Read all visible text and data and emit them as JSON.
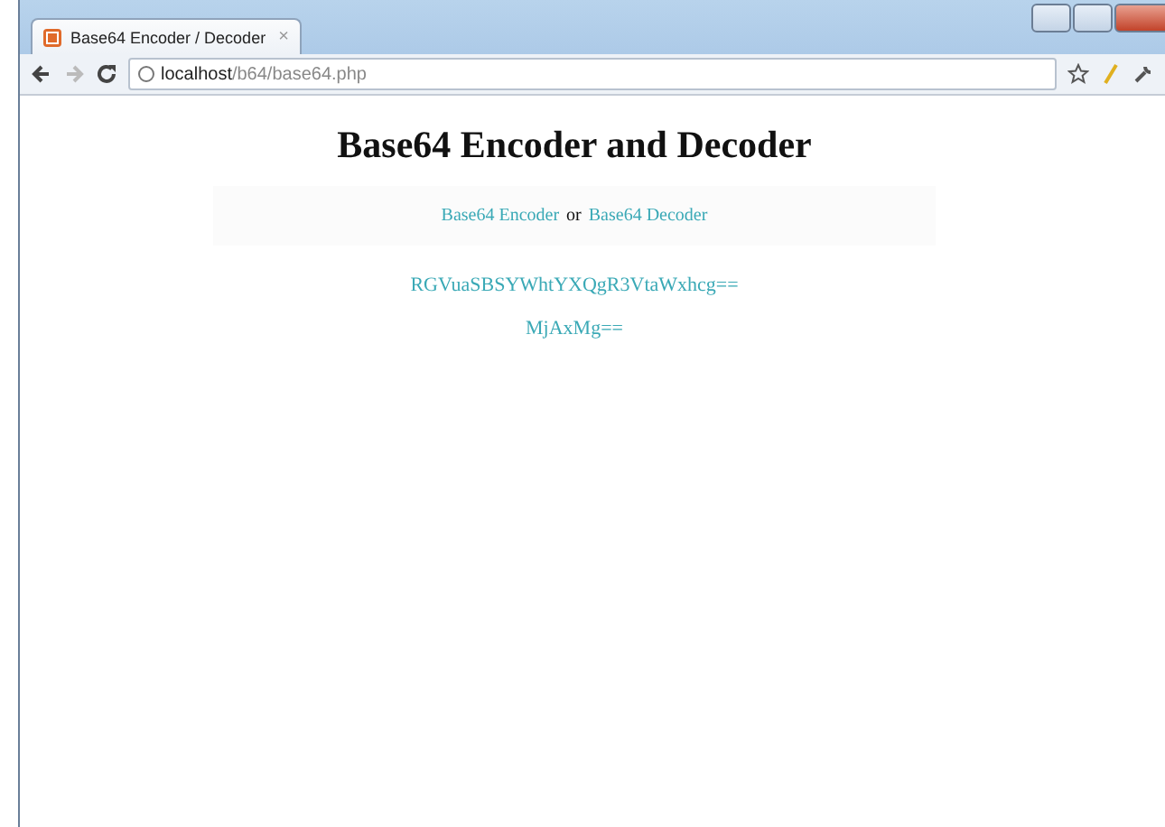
{
  "window": {
    "tab_title": "Base64 Encoder / Decoder",
    "tab_close": "×"
  },
  "address_bar": {
    "host": "localhost",
    "path": "/b64/base64.php"
  },
  "page": {
    "heading": "Base64 Encoder and Decoder",
    "nav": [
      {
        "kind": "link",
        "text": "Base64 Encoder"
      },
      {
        "kind": "text",
        "text": "or"
      },
      {
        "kind": "link",
        "text": "Base64 Decoder"
      }
    ],
    "results": [
      "RGVuaSBSYWhtYXQgR3VtaWxhcg==",
      "MjAxMg=="
    ]
  }
}
